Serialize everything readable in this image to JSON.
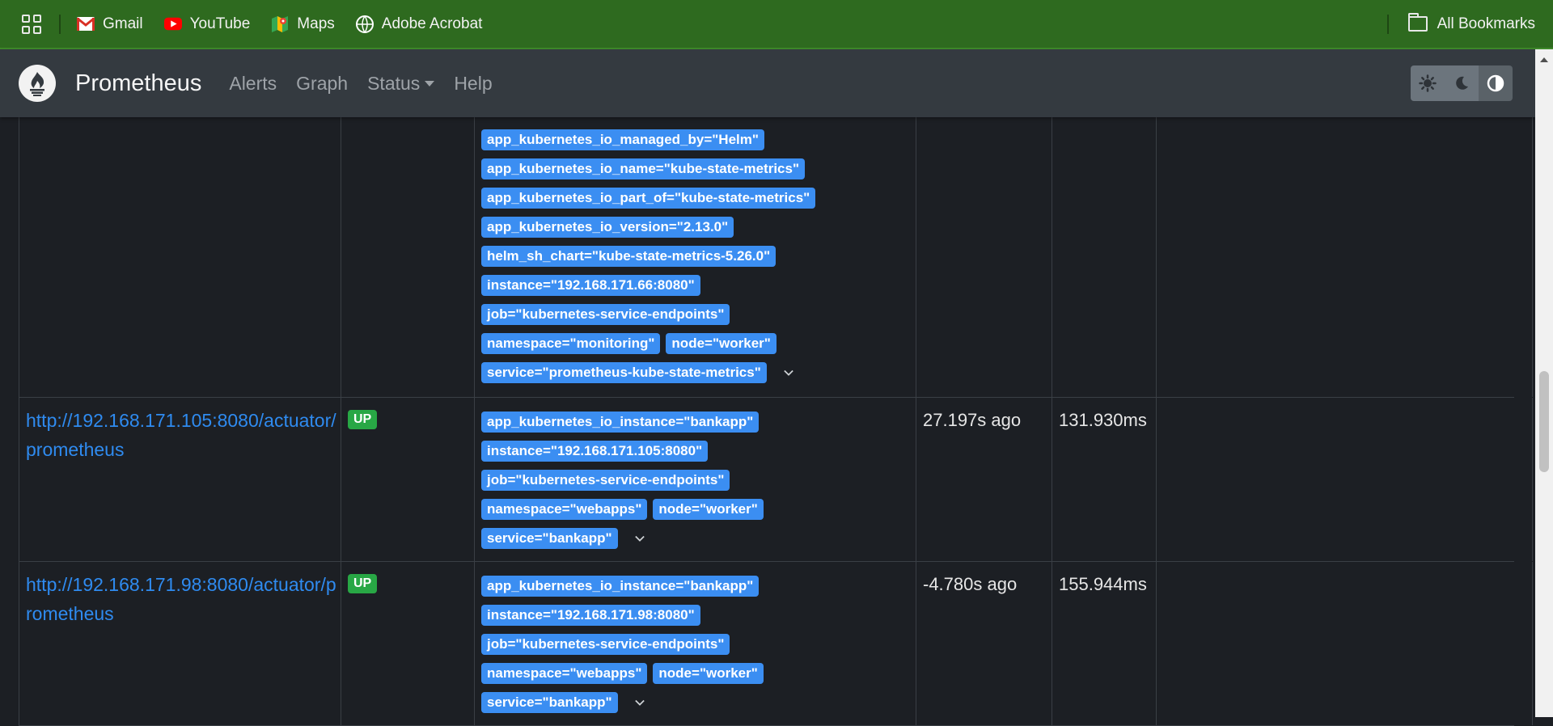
{
  "bookmarks": {
    "items": [
      {
        "label": "Gmail",
        "icon": "gmail-icon"
      },
      {
        "label": "YouTube",
        "icon": "youtube-icon"
      },
      {
        "label": "Maps",
        "icon": "maps-icon"
      },
      {
        "label": "Adobe Acrobat",
        "icon": "acrobat-icon"
      }
    ],
    "all_bookmarks": "All Bookmarks"
  },
  "navbar": {
    "brand": "Prometheus",
    "links": [
      "Alerts",
      "Graph",
      "Status",
      "Help"
    ]
  },
  "targets": [
    {
      "endpoint": "",
      "state": "",
      "labels": [
        [
          "app_kubernetes_io_managed_by=\"Helm\""
        ],
        [
          "app_kubernetes_io_name=\"kube-state-metrics\""
        ],
        [
          "app_kubernetes_io_part_of=\"kube-state-metrics\""
        ],
        [
          "app_kubernetes_io_version=\"2.13.0\""
        ],
        [
          "helm_sh_chart=\"kube-state-metrics-5.26.0\""
        ],
        [
          "instance=\"192.168.171.66:8080\""
        ],
        [
          "job=\"kubernetes-service-endpoints\""
        ],
        [
          "namespace=\"monitoring\"",
          "node=\"worker\""
        ],
        [
          "service=\"prometheus-kube-state-metrics\""
        ]
      ],
      "last_scrape": "",
      "duration": ""
    },
    {
      "endpoint": "http://192.168.171.105:8080/actuator/prometheus",
      "state": "UP",
      "labels": [
        [
          "app_kubernetes_io_instance=\"bankapp\""
        ],
        [
          "instance=\"192.168.171.105:8080\""
        ],
        [
          "job=\"kubernetes-service-endpoints\""
        ],
        [
          "namespace=\"webapps\"",
          "node=\"worker\""
        ],
        [
          "service=\"bankapp\""
        ]
      ],
      "last_scrape": "27.197s ago",
      "duration": "131.930ms"
    },
    {
      "endpoint": "http://192.168.171.98:8080/actuator/prometheus",
      "state": "UP",
      "labels": [
        [
          "app_kubernetes_io_instance=\"bankapp\""
        ],
        [
          "instance=\"192.168.171.98:8080\""
        ],
        [
          "job=\"kubernetes-service-endpoints\""
        ],
        [
          "namespace=\"webapps\"",
          "node=\"worker\""
        ],
        [
          "service=\"bankapp\""
        ]
      ],
      "last_scrape": "-4.780s ago",
      "duration": "155.944ms"
    }
  ]
}
